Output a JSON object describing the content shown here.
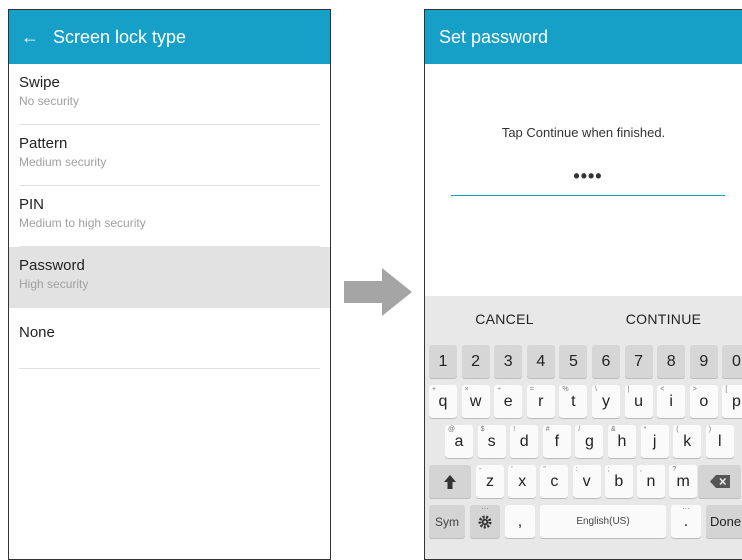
{
  "left_screen": {
    "title": "Screen lock type",
    "items": [
      {
        "title": "Swipe",
        "subtitle": "No security",
        "selected": false
      },
      {
        "title": "Pattern",
        "subtitle": "Medium security",
        "selected": false
      },
      {
        "title": "PIN",
        "subtitle": "Medium to high security",
        "selected": false
      },
      {
        "title": "Password",
        "subtitle": "High security",
        "selected": true
      },
      {
        "title": "None",
        "subtitle": "",
        "selected": false
      }
    ]
  },
  "right_screen": {
    "title": "Set password",
    "instruction": "Tap Continue when finished.",
    "password_masked": "••••"
  },
  "keyboard": {
    "cancel_label": "CANCEL",
    "continue_label": "CONTINUE",
    "number_row": [
      "1",
      "2",
      "3",
      "4",
      "5",
      "6",
      "7",
      "8",
      "9",
      "0"
    ],
    "row1": [
      {
        "k": "q",
        "s": "+"
      },
      {
        "k": "w",
        "s": "×"
      },
      {
        "k": "e",
        "s": "÷"
      },
      {
        "k": "r",
        "s": "="
      },
      {
        "k": "t",
        "s": "%"
      },
      {
        "k": "y",
        "s": "\\"
      },
      {
        "k": "u",
        "s": "|"
      },
      {
        "k": "i",
        "s": "<"
      },
      {
        "k": "o",
        "s": ">"
      },
      {
        "k": "p",
        "s": "["
      }
    ],
    "row2": [
      {
        "k": "a",
        "s": "@"
      },
      {
        "k": "s",
        "s": "$"
      },
      {
        "k": "d",
        "s": "!"
      },
      {
        "k": "f",
        "s": "#"
      },
      {
        "k": "g",
        "s": "/"
      },
      {
        "k": "h",
        "s": "&"
      },
      {
        "k": "j",
        "s": "*"
      },
      {
        "k": "k",
        "s": "("
      },
      {
        "k": "l",
        "s": ")"
      }
    ],
    "row3": [
      {
        "k": "z",
        "s": "-"
      },
      {
        "k": "x",
        "s": "'"
      },
      {
        "k": "c",
        "s": "\""
      },
      {
        "k": "v",
        "s": ":"
      },
      {
        "k": "b",
        "s": ";"
      },
      {
        "k": "n",
        "s": ","
      },
      {
        "k": "m",
        "s": "?"
      }
    ],
    "sym_label": "Sym",
    "comma": ",",
    "space_label": "English(US)",
    "period": ".",
    "done_label": "Done",
    "colors": {
      "accent": "#16a0c8",
      "keyboard_bg": "#e8e8e8"
    }
  }
}
